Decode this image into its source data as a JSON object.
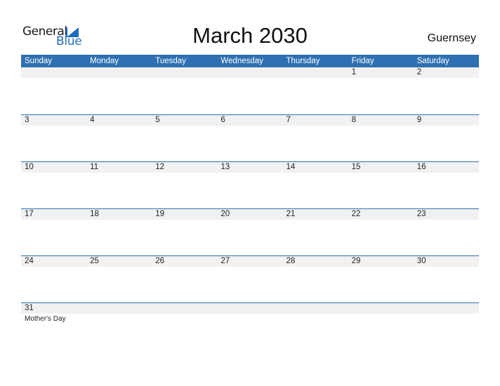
{
  "logo": {
    "line1": "General",
    "line2": "Blue"
  },
  "title": "March 2030",
  "region": "Guernsey",
  "colors": {
    "header_bg": "#2e70b2",
    "band_bg": "#f1f1f1",
    "accent": "#1f6fbf"
  },
  "weekdays": [
    "Sunday",
    "Monday",
    "Tuesday",
    "Wednesday",
    "Thursday",
    "Friday",
    "Saturday"
  ],
  "weeks": [
    [
      {
        "num": ""
      },
      {
        "num": ""
      },
      {
        "num": ""
      },
      {
        "num": ""
      },
      {
        "num": ""
      },
      {
        "num": "1"
      },
      {
        "num": "2"
      }
    ],
    [
      {
        "num": "3"
      },
      {
        "num": "4"
      },
      {
        "num": "5"
      },
      {
        "num": "6"
      },
      {
        "num": "7"
      },
      {
        "num": "8"
      },
      {
        "num": "9"
      }
    ],
    [
      {
        "num": "10"
      },
      {
        "num": "11"
      },
      {
        "num": "12"
      },
      {
        "num": "13"
      },
      {
        "num": "14"
      },
      {
        "num": "15"
      },
      {
        "num": "16"
      }
    ],
    [
      {
        "num": "17"
      },
      {
        "num": "18"
      },
      {
        "num": "19"
      },
      {
        "num": "20"
      },
      {
        "num": "21"
      },
      {
        "num": "22"
      },
      {
        "num": "23"
      }
    ],
    [
      {
        "num": "24"
      },
      {
        "num": "25"
      },
      {
        "num": "26"
      },
      {
        "num": "27"
      },
      {
        "num": "28"
      },
      {
        "num": "29"
      },
      {
        "num": "30"
      }
    ],
    [
      {
        "num": "31",
        "event": "Mother's Day"
      },
      {
        "num": ""
      },
      {
        "num": ""
      },
      {
        "num": ""
      },
      {
        "num": ""
      },
      {
        "num": ""
      },
      {
        "num": ""
      }
    ]
  ]
}
